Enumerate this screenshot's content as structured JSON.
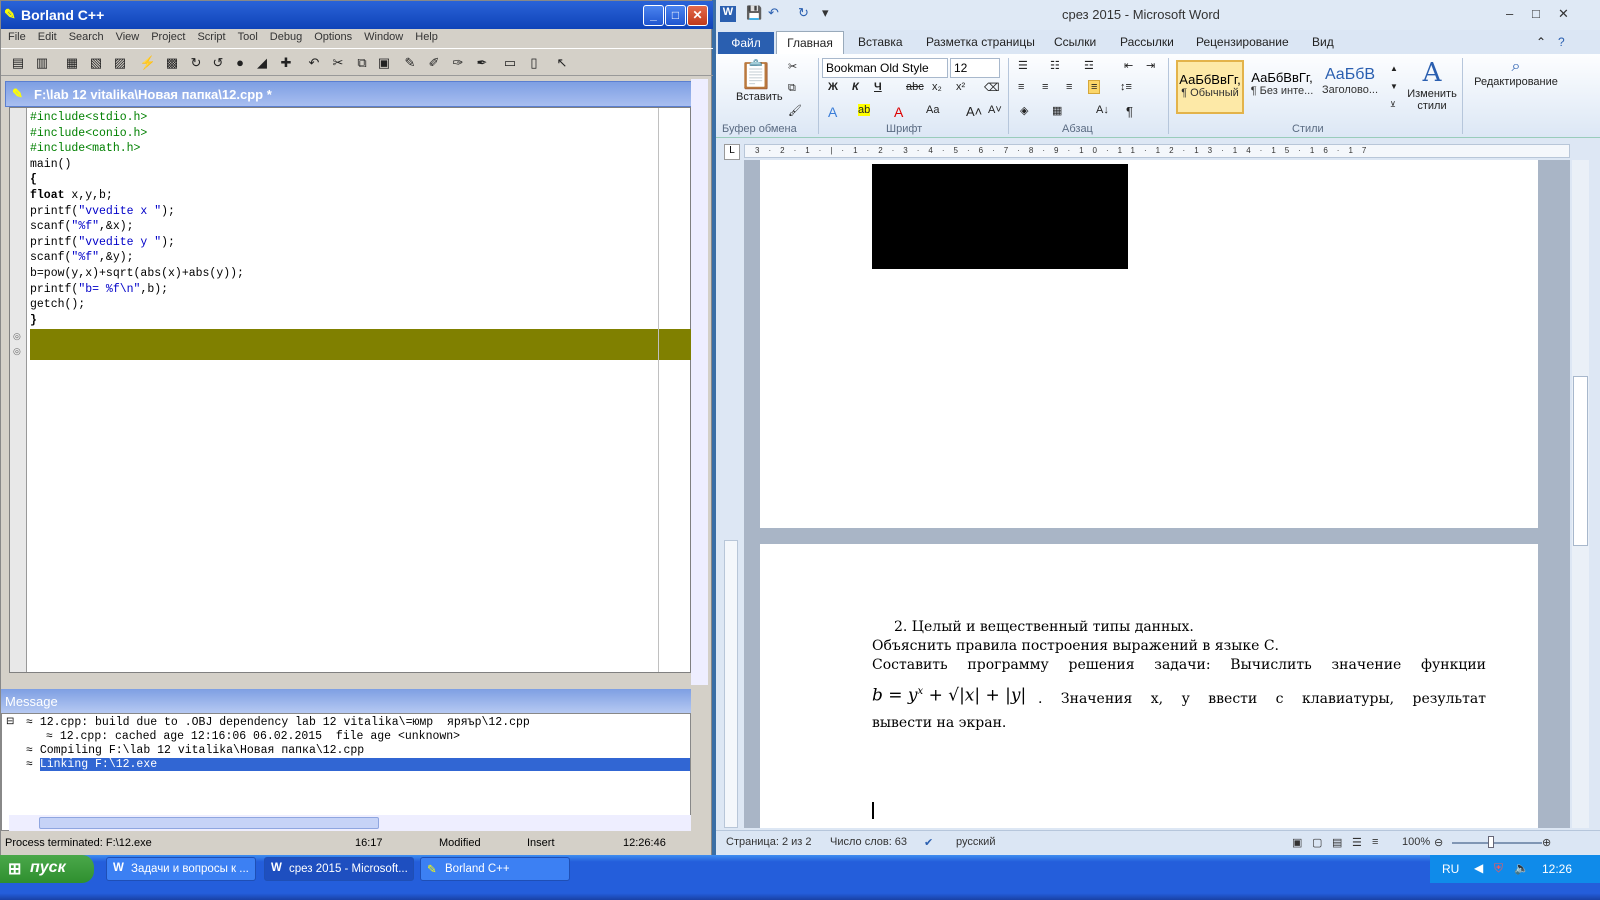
{
  "borland": {
    "title": "Borland C++",
    "menu": [
      "File",
      "Edit",
      "Search",
      "View",
      "Project",
      "Script",
      "Tool",
      "Debug",
      "Options",
      "Window",
      "Help"
    ],
    "doc_title": "F:\\lab 12 vitalika\\Новая папка\\12.cpp *",
    "code": {
      "l1": "#include<stdio.h>",
      "l2": "#include<conio.h>",
      "l3": "#include<math.h>",
      "l4": "main()",
      "l5": "{",
      "l6a": "float",
      "l6b": " x,y,b;",
      "l7a": "printf(",
      "l7b": "\"vvedite x \"",
      "l7c": ");",
      "l8a": "scanf(",
      "l8b": "\"%f\"",
      "l8c": ",&x);",
      "l9a": "printf(",
      "l9b": "\"vvedite y \"",
      "l9c": ");",
      "l10a": "scanf(",
      "l10b": "\"%f\"",
      "l10c": ",&y);",
      "l11": "b=pow(y,x)+sqrt(abs(x)+abs(y));",
      "l12a": "printf(",
      "l12b": "\"b= %f\\n\"",
      "l12c": ",b);",
      "l13": "getch();",
      "l14": "}"
    },
    "message_title": "Message",
    "messages": [
      "12.cpp: build due to .OBJ dependency lab 12 vitalika\\=юмр  яряър\\12.cpp",
      "12.cpp: cached age 12:16:06 06.02.2015  file age <unknown>",
      "Compiling F:\\lab 12 vitalika\\Новая папка\\12.cpp",
      "Linking F:\\12.exe"
    ],
    "status": {
      "text": "Process terminated: F:\\12.exe",
      "pos": "16:17",
      "modified": "Modified",
      "mode": "Insert",
      "time": "12:26:46"
    }
  },
  "word": {
    "title": "срез 2015  -  Microsoft Word",
    "tabs": {
      "file": "Файл",
      "home": "Главная",
      "insert": "Вставка",
      "layout": "Разметка страницы",
      "refs": "Ссылки",
      "mail": "Рассылки",
      "review": "Рецензирование",
      "view": "Вид"
    },
    "paste": "Вставить",
    "font_name": "Bookman Old Style",
    "font_size": "12",
    "styles": [
      {
        "sample": "АаБбВвГг,",
        "name": "¶ Обычный"
      },
      {
        "sample": "АаБбВвГг,",
        "name": "¶ Без инте..."
      },
      {
        "sample": "АаБбВ",
        "name": "Заголово..."
      }
    ],
    "change_styles": "Изменить стили",
    "editing": "Редактирование",
    "groups": {
      "clipboard": "Буфер обмена",
      "font": "Шрифт",
      "paragraph": "Абзац",
      "styles": "Стили"
    },
    "doc": {
      "item": "2.  Целый и вещественный типы данных.",
      "line2": "Объяснить правила построения выражений в языке С.",
      "line3": "Составить программу решения задачи: Вычислить значение функции",
      "formula": "b = y",
      "formula_sup": "x",
      "formula_rest": " + √|x| + |y|",
      "line4": ". Значения х, у ввести с клавиатуры,  результат",
      "line5": "вывести на экран."
    },
    "status": {
      "page": "Страница: 2 из 2",
      "words": "Число слов: 63",
      "lang": "русский",
      "zoom": "100%"
    }
  },
  "taskbar": {
    "start": "пуск",
    "tasks": [
      "Задачи и вопросы к ...",
      "срез 2015 - Microsoft...",
      "Borland C++"
    ],
    "lang": "RU",
    "clock": "12:26"
  }
}
